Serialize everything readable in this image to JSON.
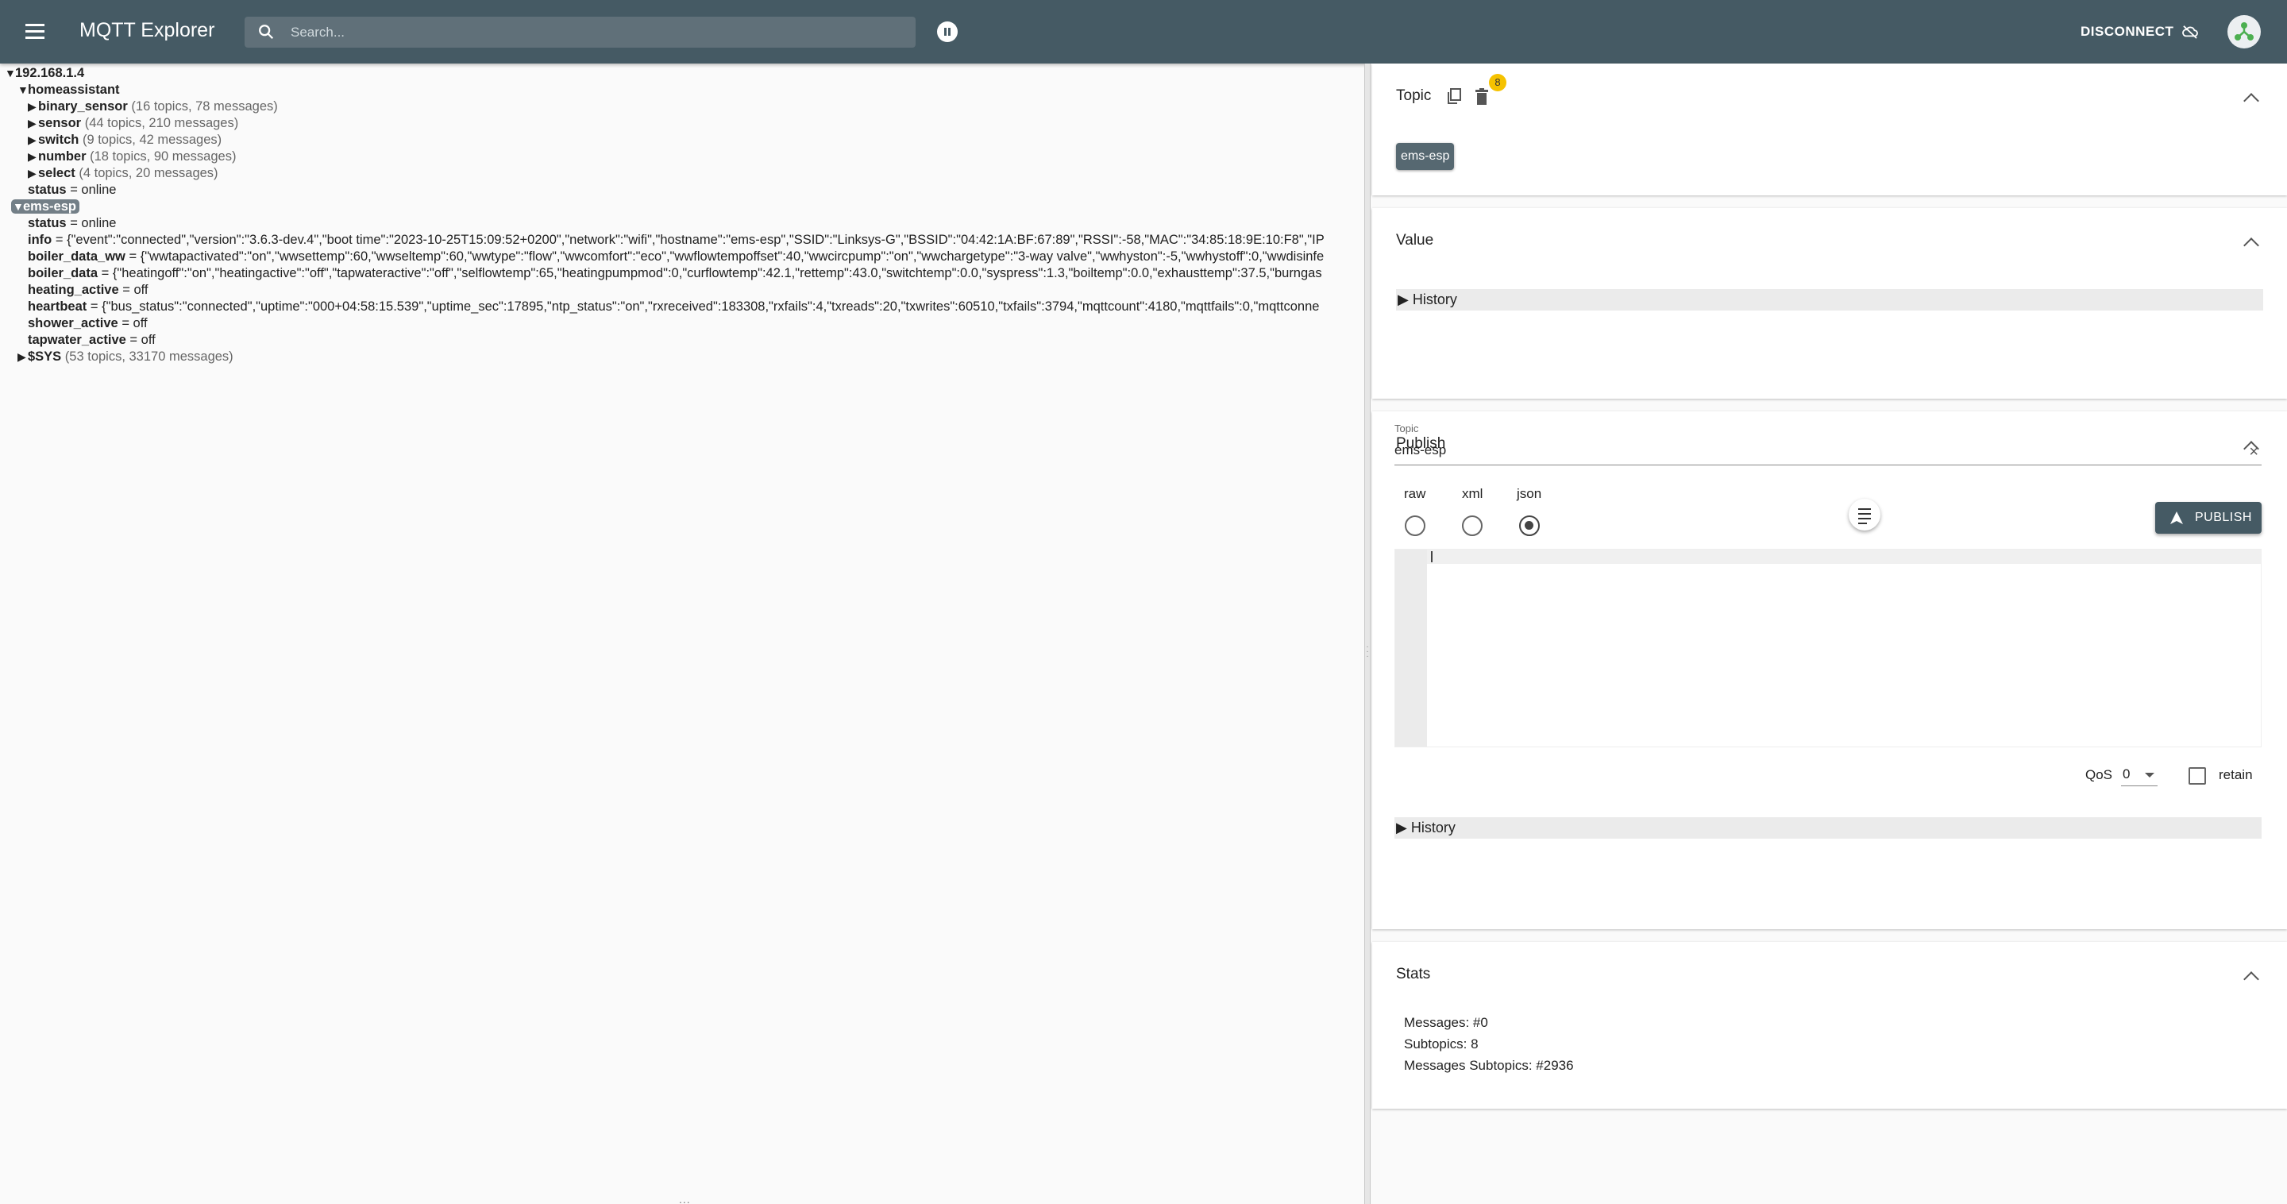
{
  "header": {
    "title": "MQTT Explorer",
    "search_placeholder": "Search...",
    "disconnect_label": "DISCONNECT"
  },
  "tree": {
    "root": "192.168.1.4",
    "homeassistant": {
      "name": "homeassistant",
      "children": [
        {
          "name": "binary_sensor",
          "meta": "(16 topics, 78 messages)"
        },
        {
          "name": "sensor",
          "meta": "(44 topics, 210 messages)"
        },
        {
          "name": "switch",
          "meta": "(9 topics, 42 messages)"
        },
        {
          "name": "number",
          "meta": "(18 topics, 90 messages)"
        },
        {
          "name": "select",
          "meta": "(4 topics, 20 messages)"
        }
      ],
      "status": {
        "name": "status",
        "value": "= online"
      }
    },
    "ems_esp": {
      "name": "ems-esp",
      "children": [
        {
          "name": "status",
          "value": "= online"
        },
        {
          "name": "info",
          "value": "= {\"event\":\"connected\",\"version\":\"3.6.3-dev.4\",\"boot time\":\"2023-10-25T15:09:52+0200\",\"network\":\"wifi\",\"hostname\":\"ems-esp\",\"SSID\":\"Linksys-G\",\"BSSID\":\"04:42:1A:BF:67:89\",\"RSSI\":-58,\"MAC\":\"34:85:18:9E:10:F8\",\"IP"
        },
        {
          "name": "boiler_data_ww",
          "value": "= {\"wwtapactivated\":\"on\",\"wwsettemp\":60,\"wwseltemp\":60,\"wwtype\":\"flow\",\"wwcomfort\":\"eco\",\"wwflowtempoffset\":40,\"wwcircpump\":\"on\",\"wwchargetype\":\"3-way valve\",\"wwhyston\":-5,\"wwhystoff\":0,\"wwdisinfe"
        },
        {
          "name": "boiler_data",
          "value": "= {\"heatingoff\":\"on\",\"heatingactive\":\"off\",\"tapwateractive\":\"off\",\"selflowtemp\":65,\"heatingpumpmod\":0,\"curflowtemp\":42.1,\"rettemp\":43.0,\"switchtemp\":0.0,\"syspress\":1.3,\"boiltemp\":0.0,\"exhausttemp\":37.5,\"burngas"
        },
        {
          "name": "heating_active",
          "value": "= off"
        },
        {
          "name": "heartbeat",
          "value": "= {\"bus_status\":\"connected\",\"uptime\":\"000+04:58:15.539\",\"uptime_sec\":17895,\"ntp_status\":\"on\",\"rxreceived\":183308,\"rxfails\":4,\"txreads\":20,\"txwrites\":60510,\"txfails\":3794,\"mqttcount\":4180,\"mqttfails\":0,\"mqttconne"
        },
        {
          "name": "shower_active",
          "value": "= off"
        },
        {
          "name": "tapwater_active",
          "value": "= off"
        }
      ]
    },
    "sys": {
      "name": "$SYS",
      "meta": "(53 topics, 33170 messages)"
    },
    "bottom_handle": "..."
  },
  "sidebar": {
    "topic_panel": {
      "title": "Topic",
      "badge": "8",
      "chip": "ems-esp"
    },
    "value_panel": {
      "title": "Value",
      "history": "History"
    },
    "publish_panel": {
      "title": "Publish",
      "topic_label": "Topic",
      "topic_value": "ems-esp",
      "formats": [
        "raw",
        "xml",
        "json"
      ],
      "selected_format": "json",
      "publish_label": "PUBLISH",
      "qos_label": "QoS",
      "qos_value": "0",
      "retain_label": "retain",
      "history": "History"
    },
    "stats_panel": {
      "title": "Stats",
      "lines": [
        "Messages: #0",
        "Subtopics: 8",
        "Messages Subtopics: #2936"
      ]
    }
  }
}
